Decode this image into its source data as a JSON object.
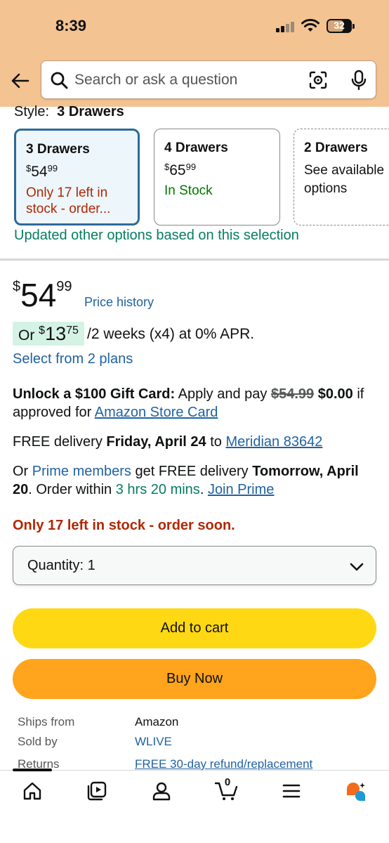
{
  "status_bar": {
    "time": "8:39",
    "battery": "32"
  },
  "search": {
    "placeholder": "Search or ask a question"
  },
  "style_section": {
    "label": "Style:",
    "selected": "3 Drawers",
    "options": [
      {
        "name": "3 Drawers",
        "price_symbol": "$",
        "price_whole": "54",
        "price_fraction": "99",
        "status": "Only 17 left in stock - order..."
      },
      {
        "name": "4 Drawers",
        "price_symbol": "$",
        "price_whole": "65",
        "price_fraction": "99",
        "status": "In Stock"
      },
      {
        "name": "2 Drawers",
        "status": "See available options"
      }
    ],
    "updated_note": "Updated other options based on this selection"
  },
  "price": {
    "symbol": "$",
    "whole": "54",
    "fraction": "99",
    "history_link": "Price history"
  },
  "installment": {
    "prefix": "Or",
    "symbol": "$",
    "whole": "13",
    "fraction": "75",
    "rest": "/2 weeks (x4) at 0% APR.",
    "select_plans": "Select from 2 plans"
  },
  "gift_card": {
    "title": "Unlock a $100 Gift Card:",
    "text": "Apply and pay",
    "old_price": "$54.99",
    "new_price": "$0.00",
    "text2": "if approved for",
    "link": "Amazon Store Card"
  },
  "delivery": {
    "prefix": "FREE delivery",
    "date": "Friday, April 24",
    "to": "to",
    "location": "Meridian 83642"
  },
  "prime_delivery": {
    "prefix": "Or",
    "members_link": "Prime members",
    "text": "get FREE delivery",
    "date": "Tomorrow, April 20",
    "order_within": ". Order within",
    "countdown": "3 hrs 20 mins",
    "dot": ".",
    "join_link": "Join Prime"
  },
  "stock_warning": "Only 17 left in stock - order soon.",
  "quantity": {
    "label": "Quantity:",
    "value": "1"
  },
  "buttons": {
    "add_to_cart": "Add to cart",
    "buy_now": "Buy Now"
  },
  "seller_info": [
    {
      "key": "Ships from",
      "value": "Amazon"
    },
    {
      "key": "Sold by",
      "value": "WLIVE"
    },
    {
      "key": "Returns",
      "value": "FREE 30-day refund/replacement"
    }
  ],
  "bottom_nav": {
    "cart_count": "0"
  },
  "colors": {
    "header_bg": "#f3c392",
    "add_to_cart": "#ffd814",
    "buy_now": "#ffa41c",
    "link": "#2162a1",
    "stock_red": "#b12704",
    "green": "#067d62"
  }
}
